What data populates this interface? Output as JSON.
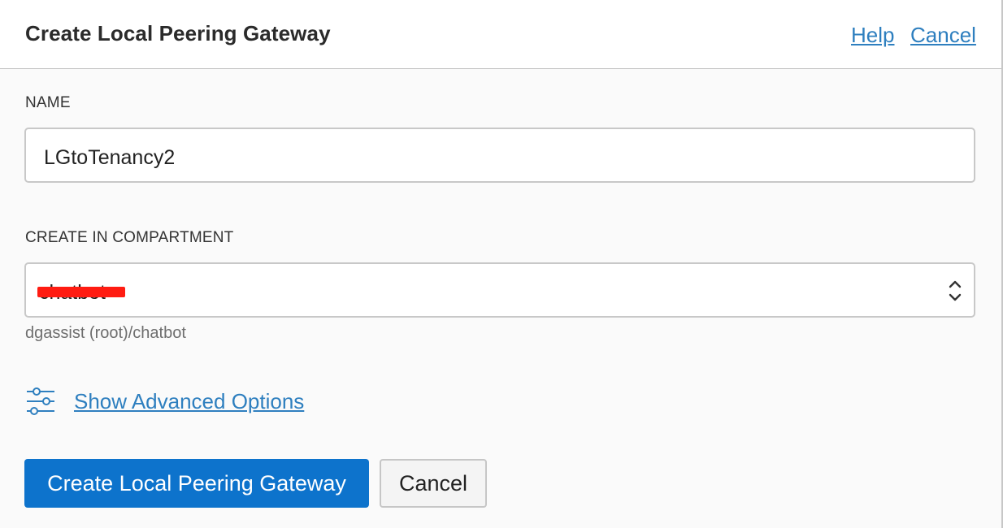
{
  "header": {
    "title": "Create Local Peering Gateway",
    "help_label": "Help",
    "cancel_label": "Cancel"
  },
  "form": {
    "name_label": "NAME",
    "name_value": "LGtoTenancy2",
    "compartment_label": "CREATE IN COMPARTMENT",
    "compartment_value": "chatbot",
    "compartment_path": "dgassist (root)/chatbot",
    "advanced_options_label": "Show Advanced Options",
    "advanced_options_icon": "sliders-icon"
  },
  "footer": {
    "submit_label": "Create Local Peering Gateway",
    "cancel_label": "Cancel"
  },
  "colors": {
    "link": "#2e7fbf",
    "primary_button": "#0d73cc",
    "redaction": "#ff1c12"
  }
}
